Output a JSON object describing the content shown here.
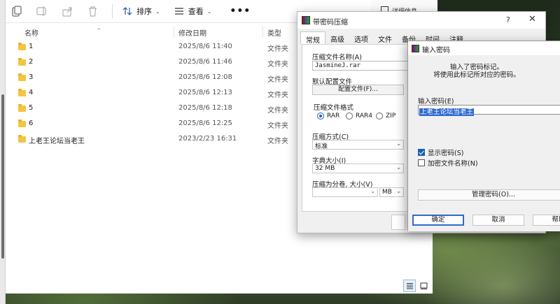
{
  "explorer": {
    "toolbar": {
      "sort_label": "排序",
      "view_label": "查看",
      "more_label": "•••"
    },
    "columns": {
      "name": "名称",
      "date": "修改日期",
      "type": "类型"
    },
    "rows": [
      {
        "name": "1",
        "date": "2025/8/6 11:40",
        "type": "文件夹"
      },
      {
        "name": "2",
        "date": "2025/8/6 11:46",
        "type": "文件夹"
      },
      {
        "name": "3",
        "date": "2025/8/6 12:08",
        "type": "文件夹"
      },
      {
        "name": "4",
        "date": "2025/8/6 12:13",
        "type": "文件夹"
      },
      {
        "name": "5",
        "date": "2025/8/6 12:18",
        "type": "文件夹"
      },
      {
        "name": "6",
        "date": "2025/8/6 12:25",
        "type": "文件夹"
      },
      {
        "name": "上老王论坛当老王",
        "date": "2023/2/23 16:31",
        "type": "文件夹"
      }
    ]
  },
  "back_window": {
    "title": "详细信息"
  },
  "rar_dialog": {
    "title": "带密码压缩",
    "tabs": [
      "常规",
      "高级",
      "选项",
      "文件",
      "备份",
      "时间",
      "注释"
    ],
    "archive_name_label": "压缩文件名称(A)",
    "archive_name_value": "JasmineJ.rar",
    "default_profile_label": "默认配置文件",
    "profile_button": "配置文件(F)...",
    "format_label": "压缩文件格式",
    "formats": [
      "RAR",
      "RAR4",
      "ZIP"
    ],
    "selected_format": "RAR",
    "method_label": "压缩方式(C)",
    "method_value": "标准",
    "dict_label": "字典大小(I)",
    "dict_value": "32 MB",
    "split_label": "压缩为分卷, 大小(V)",
    "split_value": "",
    "split_unit": "MB"
  },
  "password_dialog": {
    "title": "输入密码",
    "info_line1": "输入了密码标记。",
    "info_line2": "将使用此标记所对应的密码。",
    "enter_label": "输入密码(E)",
    "password_value": "上老王论坛当老王",
    "show_password_label": "显示密码(S)",
    "show_password_checked": true,
    "encrypt_names_label": "加密文件名称(N)",
    "encrypt_names_checked": false,
    "manage_button": "管理密码(O)...",
    "ok_button": "确定",
    "cancel_button": "取消",
    "help_button": "帮助"
  }
}
